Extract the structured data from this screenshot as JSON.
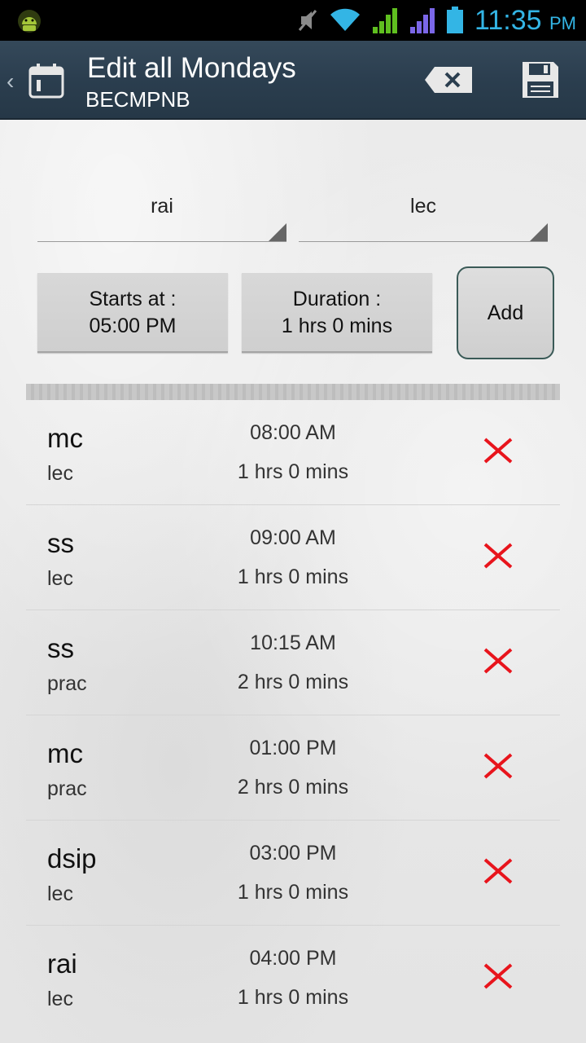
{
  "status_bar": {
    "time": "11:35",
    "ampm": "PM"
  },
  "action_bar": {
    "title": "Edit all Mondays",
    "subtitle": "BECMPNB"
  },
  "form": {
    "subject_spinner": "rai",
    "type_spinner": "lec",
    "starts_label": "Starts at :",
    "starts_value": "05:00 PM",
    "duration_label": "Duration :",
    "duration_value": "1 hrs 0 mins",
    "add_label": "Add"
  },
  "entries": [
    {
      "subject": "mc",
      "kind": "lec",
      "time": "08:00 AM",
      "duration": "1 hrs 0 mins"
    },
    {
      "subject": "ss",
      "kind": "lec",
      "time": "09:00 AM",
      "duration": "1 hrs 0 mins"
    },
    {
      "subject": "ss",
      "kind": "prac",
      "time": "10:15 AM",
      "duration": "2 hrs 0 mins"
    },
    {
      "subject": "mc",
      "kind": "prac",
      "time": "01:00 PM",
      "duration": "2 hrs 0 mins"
    },
    {
      "subject": "dsip",
      "kind": "lec",
      "time": "03:00 PM",
      "duration": "1 hrs 0 mins"
    },
    {
      "subject": "rai",
      "kind": "lec",
      "time": "04:00 PM",
      "duration": "1 hrs 0 mins"
    }
  ]
}
